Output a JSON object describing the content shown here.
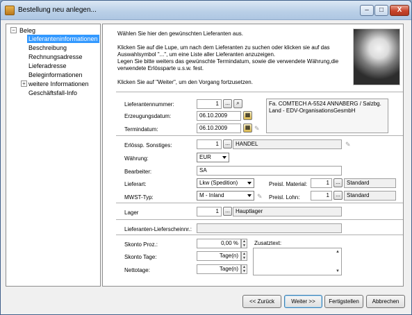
{
  "window": {
    "title": "Bestellung neu anlegen...",
    "controls": {
      "minimize": "–",
      "maximize": "□",
      "close": "X"
    }
  },
  "tree": {
    "root": "Beleg",
    "items": [
      {
        "label": "Lieferanteninformationen",
        "selected": true
      },
      {
        "label": "Beschreibung"
      },
      {
        "label": "Rechnungsadresse"
      },
      {
        "label": "Lieferadresse"
      },
      {
        "label": "Beleginformationen"
      },
      {
        "label": "weitere Informationen",
        "expandable": true
      },
      {
        "label": "Geschäftsfall-Info"
      }
    ],
    "expand_symbol": "−",
    "collapsed_symbol": "+"
  },
  "intro": {
    "p1": "Wählen Sie hier den gewünschten Lieferanten aus.",
    "p2": "Klicken Sie auf die Lupe, um nach dem Lieferanten zu suchen oder klicken sie auf das Auswahlsymbol \"...\", um eine Liste aller Lieferanten anzuzeigen.",
    "p3": "Legen Sie bitte weiters das gewünschte Termindatum, sowie die verwendete Währung,die verwendete Erlössparte u.s.w. fest.",
    "p4": "Klicken Sie auf \"Weiter\", um den Vorgang fortzusetzen."
  },
  "supplier": {
    "number_label": "Lieferantennummer:",
    "number_value": "1",
    "created_label": "Erzeugungsdatum:",
    "created_value": "06.10.2009",
    "term_label": "Termindatum:",
    "term_value": "06.10.2009",
    "address": "Fa. COMTECH A-5524 ANNABERG / Salzbg. Land  - EDV-OrganisationsGesmbH"
  },
  "revenue": {
    "label": "Erlössp. Sonstiges:",
    "value": "1",
    "name": "HANDEL",
    "currency_label": "Währung:",
    "currency_value": "EUR",
    "editor_label": "Bearbeiter:",
    "editor_value": "SA",
    "delivery_label": "Lieferart:",
    "delivery_value": "Lkw (Spedition)",
    "vat_label": "MWST-Typ:",
    "vat_value": "M - Inland",
    "price_material_label": "Preisl. Material:",
    "price_material_value": "1",
    "price_material_name": "Standard",
    "price_wage_label": "Preisl. Lohn:",
    "price_wage_value": "1",
    "price_wage_name": "Standard"
  },
  "storage": {
    "label": "Lager",
    "value": "1",
    "name": "Hauptlager"
  },
  "delivery_note": {
    "label": "Lieferanten-Lieferscheinnr.:",
    "value": ""
  },
  "terms": {
    "discount_label": "Skonto Proz.:",
    "discount_value": "0,00 %",
    "discount_days_label": "Skonto Tage:",
    "discount_days_value": "Tage(n)",
    "net_days_label": "Nettotage:",
    "net_days_value": "Tage(n)",
    "extra_text_label": "Zusatztext:"
  },
  "buttons": {
    "back": "<< Zurück",
    "next": "Weiter >>",
    "finish": "Fertigstellen",
    "cancel": "Abbrechen"
  },
  "glyphs": {
    "ellipsis": "...",
    "magnifier": "⌕",
    "calendar": "▦",
    "pencil": "✎",
    "up": "▲",
    "down": "▼"
  }
}
